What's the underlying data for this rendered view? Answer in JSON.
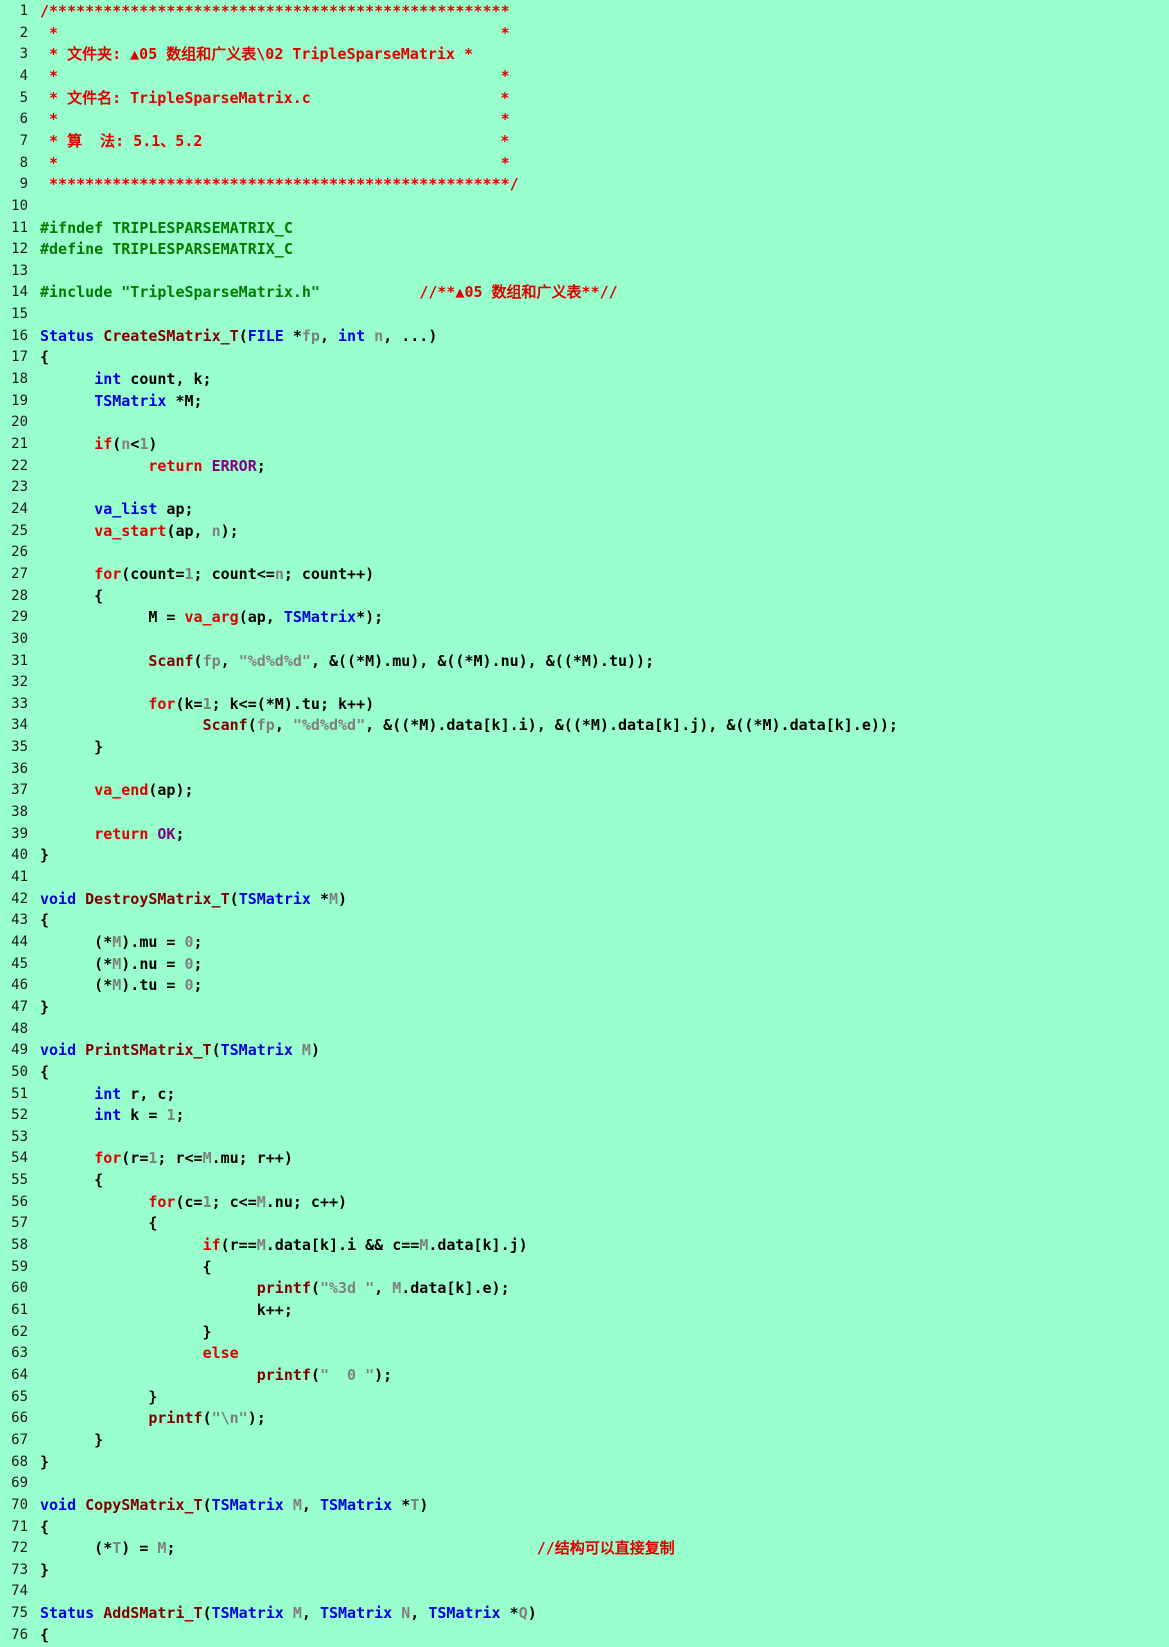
{
  "colors": {
    "background": "#99ffcc",
    "comment": "#e00000",
    "preprocessor": "#007a00",
    "keyword": "#0000dd",
    "function": "#800000",
    "control": "#dd0000",
    "constant": "#800080",
    "param": "#7f7f7f"
  },
  "lines": [
    {
      "n": "1",
      "t": [
        [
          "comment",
          "/***************************************************"
        ]
      ]
    },
    {
      "n": "2",
      "t": [
        [
          "comment",
          " *                                                 *"
        ]
      ]
    },
    {
      "n": "3",
      "t": [
        [
          "comment",
          " * 文件夹: ▲05 数组和广义表\\02 TripleSparseMatrix *"
        ]
      ]
    },
    {
      "n": "4",
      "t": [
        [
          "comment",
          " *                                                 *"
        ]
      ]
    },
    {
      "n": "5",
      "t": [
        [
          "comment",
          " * 文件名: TripleSparseMatrix.c                     *"
        ]
      ]
    },
    {
      "n": "6",
      "t": [
        [
          "comment",
          " *                                                 *"
        ]
      ]
    },
    {
      "n": "7",
      "t": [
        [
          "comment",
          " * 算  法: 5.1、5.2                                 *"
        ]
      ]
    },
    {
      "n": "8",
      "t": [
        [
          "comment",
          " *                                                 *"
        ]
      ]
    },
    {
      "n": "9",
      "t": [
        [
          "comment",
          " ***************************************************/"
        ]
      ]
    },
    {
      "n": "10",
      "t": []
    },
    {
      "n": "11",
      "t": [
        [
          "pp",
          "#ifndef TRIPLESPARSEMATRIX_C"
        ]
      ]
    },
    {
      "n": "12",
      "t": [
        [
          "pp",
          "#define TRIPLESPARSEMATRIX_C"
        ]
      ]
    },
    {
      "n": "13",
      "t": []
    },
    {
      "n": "14",
      "t": [
        [
          "pp",
          "#include \"TripleSparseMatrix.h\""
        ],
        [
          "default",
          "           "
        ],
        [
          "comment",
          "//**▲05 数组和广义表**//"
        ]
      ]
    },
    {
      "n": "15",
      "t": []
    },
    {
      "n": "16",
      "t": [
        [
          "kw",
          "Status"
        ],
        [
          "default",
          " "
        ],
        [
          "fn",
          "CreateSMatrix_T"
        ],
        [
          "default",
          "("
        ],
        [
          "kw",
          "FILE"
        ],
        [
          "default",
          " *"
        ],
        [
          "param",
          "fp"
        ],
        [
          "default",
          ", "
        ],
        [
          "kw",
          "int"
        ],
        [
          "default",
          " "
        ],
        [
          "param",
          "n"
        ],
        [
          "default",
          ", ...)"
        ]
      ]
    },
    {
      "n": "17",
      "t": [
        [
          "default",
          "{"
        ]
      ]
    },
    {
      "n": "18",
      "t": [
        [
          "default",
          "      "
        ],
        [
          "kw",
          "int"
        ],
        [
          "default",
          " count, k;"
        ]
      ]
    },
    {
      "n": "19",
      "t": [
        [
          "default",
          "      "
        ],
        [
          "kw",
          "TSMatrix"
        ],
        [
          "default",
          " *M;"
        ]
      ]
    },
    {
      "n": "20",
      "t": []
    },
    {
      "n": "21",
      "t": [
        [
          "default",
          "      "
        ],
        [
          "ctl",
          "if"
        ],
        [
          "default",
          "("
        ],
        [
          "param",
          "n"
        ],
        [
          "default",
          "<"
        ],
        [
          "num",
          "1"
        ],
        [
          "default",
          ")"
        ]
      ]
    },
    {
      "n": "22",
      "t": [
        [
          "default",
          "            "
        ],
        [
          "ctl",
          "return"
        ],
        [
          "default",
          " "
        ],
        [
          "const",
          "ERROR"
        ],
        [
          "default",
          ";"
        ]
      ]
    },
    {
      "n": "23",
      "t": []
    },
    {
      "n": "24",
      "t": [
        [
          "default",
          "      "
        ],
        [
          "kw",
          "va_list"
        ],
        [
          "default",
          " ap;"
        ]
      ]
    },
    {
      "n": "25",
      "t": [
        [
          "default",
          "      "
        ],
        [
          "ctl",
          "va_start"
        ],
        [
          "default",
          "(ap, "
        ],
        [
          "param",
          "n"
        ],
        [
          "default",
          ");"
        ]
      ]
    },
    {
      "n": "26",
      "t": []
    },
    {
      "n": "27",
      "t": [
        [
          "default",
          "      "
        ],
        [
          "ctl",
          "for"
        ],
        [
          "default",
          "(count="
        ],
        [
          "num",
          "1"
        ],
        [
          "default",
          "; count<="
        ],
        [
          "param",
          "n"
        ],
        [
          "default",
          "; count++)"
        ]
      ]
    },
    {
      "n": "28",
      "t": [
        [
          "default",
          "      {"
        ]
      ]
    },
    {
      "n": "29",
      "t": [
        [
          "default",
          "            M = "
        ],
        [
          "ctl",
          "va_arg"
        ],
        [
          "default",
          "(ap, "
        ],
        [
          "kw",
          "TSMatrix"
        ],
        [
          "default",
          "*);"
        ]
      ]
    },
    {
      "n": "30",
      "t": []
    },
    {
      "n": "31",
      "t": [
        [
          "default",
          "            "
        ],
        [
          "fn",
          "Scanf"
        ],
        [
          "default",
          "("
        ],
        [
          "param",
          "fp"
        ],
        [
          "default",
          ", "
        ],
        [
          "str",
          "\"%d%d%d\""
        ],
        [
          "default",
          ", &((*M).mu), &((*M).nu), &((*M).tu));"
        ]
      ]
    },
    {
      "n": "32",
      "t": []
    },
    {
      "n": "33",
      "t": [
        [
          "default",
          "            "
        ],
        [
          "ctl",
          "for"
        ],
        [
          "default",
          "(k="
        ],
        [
          "num",
          "1"
        ],
        [
          "default",
          "; k<=(*M).tu; k++)"
        ]
      ]
    },
    {
      "n": "34",
      "t": [
        [
          "default",
          "                  "
        ],
        [
          "fn",
          "Scanf"
        ],
        [
          "default",
          "("
        ],
        [
          "param",
          "fp"
        ],
        [
          "default",
          ", "
        ],
        [
          "str",
          "\"%d%d%d\""
        ],
        [
          "default",
          ", &((*M).data[k].i), &((*M).data[k].j), &((*M).data[k].e));"
        ]
      ]
    },
    {
      "n": "35",
      "t": [
        [
          "default",
          "      }"
        ]
      ]
    },
    {
      "n": "36",
      "t": []
    },
    {
      "n": "37",
      "t": [
        [
          "default",
          "      "
        ],
        [
          "ctl",
          "va_end"
        ],
        [
          "default",
          "(ap);"
        ]
      ]
    },
    {
      "n": "38",
      "t": []
    },
    {
      "n": "39",
      "t": [
        [
          "default",
          "      "
        ],
        [
          "ctl",
          "return"
        ],
        [
          "default",
          " "
        ],
        [
          "const",
          "OK"
        ],
        [
          "default",
          ";"
        ]
      ]
    },
    {
      "n": "40",
      "t": [
        [
          "default",
          "}"
        ]
      ]
    },
    {
      "n": "41",
      "t": []
    },
    {
      "n": "42",
      "t": [
        [
          "kw",
          "void"
        ],
        [
          "default",
          " "
        ],
        [
          "fn",
          "DestroySMatrix_T"
        ],
        [
          "default",
          "("
        ],
        [
          "kw",
          "TSMatrix"
        ],
        [
          "default",
          " *"
        ],
        [
          "param",
          "M"
        ],
        [
          "default",
          ")"
        ]
      ]
    },
    {
      "n": "43",
      "t": [
        [
          "default",
          "{"
        ]
      ]
    },
    {
      "n": "44",
      "t": [
        [
          "default",
          "      (*"
        ],
        [
          "param",
          "M"
        ],
        [
          "default",
          ").mu = "
        ],
        [
          "num",
          "0"
        ],
        [
          "default",
          ";"
        ]
      ]
    },
    {
      "n": "45",
      "t": [
        [
          "default",
          "      (*"
        ],
        [
          "param",
          "M"
        ],
        [
          "default",
          ").nu = "
        ],
        [
          "num",
          "0"
        ],
        [
          "default",
          ";"
        ]
      ]
    },
    {
      "n": "46",
      "t": [
        [
          "default",
          "      (*"
        ],
        [
          "param",
          "M"
        ],
        [
          "default",
          ").tu = "
        ],
        [
          "num",
          "0"
        ],
        [
          "default",
          ";"
        ]
      ]
    },
    {
      "n": "47",
      "t": [
        [
          "default",
          "}"
        ]
      ]
    },
    {
      "n": "48",
      "t": []
    },
    {
      "n": "49",
      "t": [
        [
          "kw",
          "void"
        ],
        [
          "default",
          " "
        ],
        [
          "fn",
          "PrintSMatrix_T"
        ],
        [
          "default",
          "("
        ],
        [
          "kw",
          "TSMatrix"
        ],
        [
          "default",
          " "
        ],
        [
          "param",
          "M"
        ],
        [
          "default",
          ")"
        ]
      ]
    },
    {
      "n": "50",
      "t": [
        [
          "default",
          "{"
        ]
      ]
    },
    {
      "n": "51",
      "t": [
        [
          "default",
          "      "
        ],
        [
          "kw",
          "int"
        ],
        [
          "default",
          " r, c;"
        ]
      ]
    },
    {
      "n": "52",
      "t": [
        [
          "default",
          "      "
        ],
        [
          "kw",
          "int"
        ],
        [
          "default",
          " k = "
        ],
        [
          "num",
          "1"
        ],
        [
          "default",
          ";"
        ]
      ]
    },
    {
      "n": "53",
      "t": []
    },
    {
      "n": "54",
      "t": [
        [
          "default",
          "      "
        ],
        [
          "ctl",
          "for"
        ],
        [
          "default",
          "(r="
        ],
        [
          "num",
          "1"
        ],
        [
          "default",
          "; r<="
        ],
        [
          "param",
          "M"
        ],
        [
          "default",
          ".mu; r++)"
        ]
      ]
    },
    {
      "n": "55",
      "t": [
        [
          "default",
          "      {"
        ]
      ]
    },
    {
      "n": "56",
      "t": [
        [
          "default",
          "            "
        ],
        [
          "ctl",
          "for"
        ],
        [
          "default",
          "(c="
        ],
        [
          "num",
          "1"
        ],
        [
          "default",
          "; c<="
        ],
        [
          "param",
          "M"
        ],
        [
          "default",
          ".nu; c++)"
        ]
      ]
    },
    {
      "n": "57",
      "t": [
        [
          "default",
          "            {"
        ]
      ]
    },
    {
      "n": "58",
      "t": [
        [
          "default",
          "                  "
        ],
        [
          "ctl",
          "if"
        ],
        [
          "default",
          "(r=="
        ],
        [
          "param",
          "M"
        ],
        [
          "default",
          ".data[k].i && c=="
        ],
        [
          "param",
          "M"
        ],
        [
          "default",
          ".data[k].j)"
        ]
      ]
    },
    {
      "n": "59",
      "t": [
        [
          "default",
          "                  {"
        ]
      ]
    },
    {
      "n": "60",
      "t": [
        [
          "default",
          "                        "
        ],
        [
          "fn",
          "printf"
        ],
        [
          "default",
          "("
        ],
        [
          "str",
          "\"%3d \""
        ],
        [
          "default",
          ", "
        ],
        [
          "param",
          "M"
        ],
        [
          "default",
          ".data[k].e);"
        ]
      ]
    },
    {
      "n": "61",
      "t": [
        [
          "default",
          "                        k++;"
        ]
      ]
    },
    {
      "n": "62",
      "t": [
        [
          "default",
          "                  }"
        ]
      ]
    },
    {
      "n": "63",
      "t": [
        [
          "default",
          "                  "
        ],
        [
          "ctl",
          "else"
        ]
      ]
    },
    {
      "n": "64",
      "t": [
        [
          "default",
          "                        "
        ],
        [
          "fn",
          "printf"
        ],
        [
          "default",
          "("
        ],
        [
          "str",
          "\"  0 \""
        ],
        [
          "default",
          ");"
        ]
      ]
    },
    {
      "n": "65",
      "t": [
        [
          "default",
          "            }"
        ]
      ]
    },
    {
      "n": "66",
      "t": [
        [
          "default",
          "            "
        ],
        [
          "fn",
          "printf"
        ],
        [
          "default",
          "("
        ],
        [
          "str",
          "\"\\n\""
        ],
        [
          "default",
          ");"
        ]
      ]
    },
    {
      "n": "67",
      "t": [
        [
          "default",
          "      }"
        ]
      ]
    },
    {
      "n": "68",
      "t": [
        [
          "default",
          "}"
        ]
      ]
    },
    {
      "n": "69",
      "t": []
    },
    {
      "n": "70",
      "t": [
        [
          "kw",
          "void"
        ],
        [
          "default",
          " "
        ],
        [
          "fn",
          "CopySMatrix_T"
        ],
        [
          "default",
          "("
        ],
        [
          "kw",
          "TSMatrix"
        ],
        [
          "default",
          " "
        ],
        [
          "param",
          "M"
        ],
        [
          "default",
          ", "
        ],
        [
          "kw",
          "TSMatrix"
        ],
        [
          "default",
          " *"
        ],
        [
          "param",
          "T"
        ],
        [
          "default",
          ")"
        ]
      ]
    },
    {
      "n": "71",
      "t": [
        [
          "default",
          "{"
        ]
      ]
    },
    {
      "n": "72",
      "t": [
        [
          "default",
          "      (*"
        ],
        [
          "param",
          "T"
        ],
        [
          "default",
          ") = "
        ],
        [
          "param",
          "M"
        ],
        [
          "default",
          ";                                        "
        ],
        [
          "comment",
          "//结构可以直接复制"
        ]
      ]
    },
    {
      "n": "73",
      "t": [
        [
          "default",
          "}"
        ]
      ]
    },
    {
      "n": "74",
      "t": []
    },
    {
      "n": "75",
      "t": [
        [
          "kw",
          "Status"
        ],
        [
          "default",
          " "
        ],
        [
          "fn",
          "AddSMatri_T"
        ],
        [
          "default",
          "("
        ],
        [
          "kw",
          "TSMatrix"
        ],
        [
          "default",
          " "
        ],
        [
          "param",
          "M"
        ],
        [
          "default",
          ", "
        ],
        [
          "kw",
          "TSMatrix"
        ],
        [
          "default",
          " "
        ],
        [
          "param",
          "N"
        ],
        [
          "default",
          ", "
        ],
        [
          "kw",
          "TSMatrix"
        ],
        [
          "default",
          " *"
        ],
        [
          "param",
          "Q"
        ],
        [
          "default",
          ")"
        ]
      ]
    },
    {
      "n": "76",
      "t": [
        [
          "default",
          "{"
        ]
      ]
    }
  ]
}
